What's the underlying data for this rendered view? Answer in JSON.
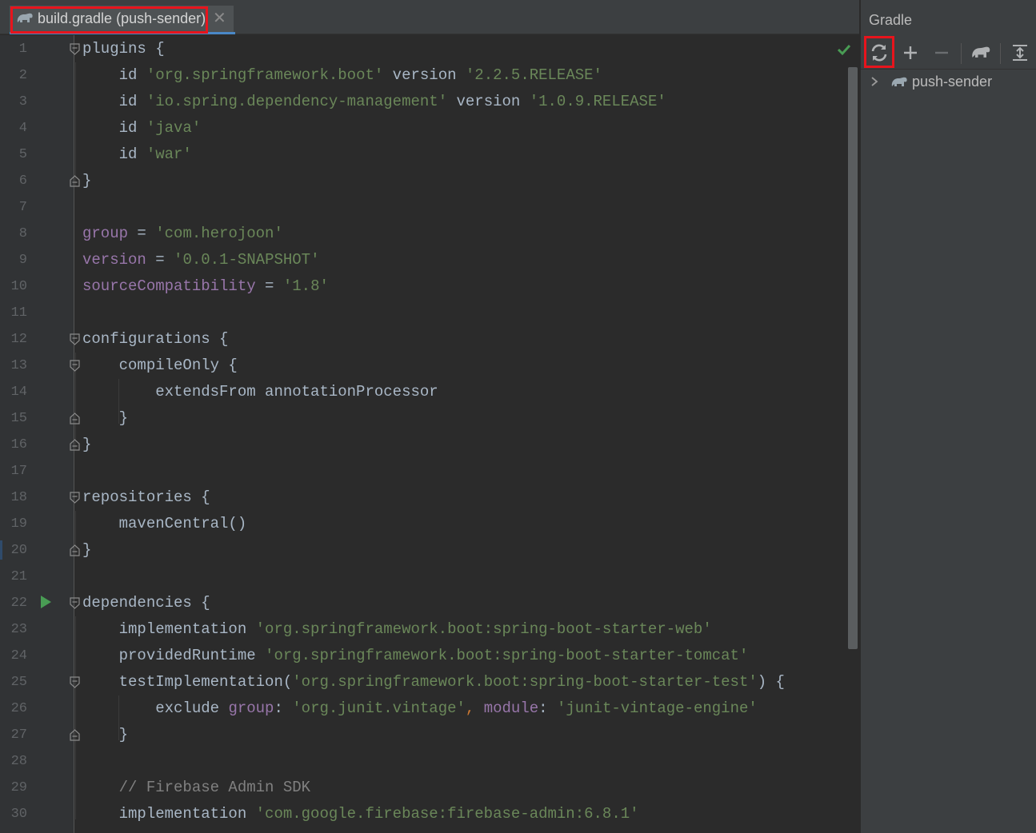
{
  "editor": {
    "tab": {
      "label": "build.gradle (push-sender)",
      "close_glyph": "✕",
      "icon": "gradle-elephant-icon"
    },
    "line_numbers": [
      "1",
      "2",
      "3",
      "4",
      "5",
      "6",
      "7",
      "8",
      "9",
      "10",
      "11",
      "12",
      "13",
      "14",
      "15",
      "16",
      "17",
      "18",
      "19",
      "20",
      "21",
      "22",
      "23",
      "24",
      "25",
      "26",
      "27",
      "28",
      "29",
      "30"
    ],
    "lines": [
      [
        {
          "t": "plugins {",
          "c": ""
        }
      ],
      [
        {
          "t": "    id ",
          "c": ""
        },
        {
          "t": "'org.springframework.boot'",
          "c": "str"
        },
        {
          "t": " version ",
          "c": ""
        },
        {
          "t": "'2.2.5.RELEASE'",
          "c": "str"
        }
      ],
      [
        {
          "t": "    id ",
          "c": ""
        },
        {
          "t": "'io.spring.dependency-management'",
          "c": "str"
        },
        {
          "t": " version ",
          "c": ""
        },
        {
          "t": "'1.0.9.RELEASE'",
          "c": "str"
        }
      ],
      [
        {
          "t": "    id ",
          "c": ""
        },
        {
          "t": "'java'",
          "c": "str"
        }
      ],
      [
        {
          "t": "    id ",
          "c": ""
        },
        {
          "t": "'war'",
          "c": "str"
        }
      ],
      [
        {
          "t": "}",
          "c": ""
        }
      ],
      [],
      [
        {
          "t": "group",
          "c": "prop"
        },
        {
          "t": " = ",
          "c": ""
        },
        {
          "t": "'com.herojoon'",
          "c": "str"
        }
      ],
      [
        {
          "t": "version",
          "c": "prop"
        },
        {
          "t": " = ",
          "c": ""
        },
        {
          "t": "'0.0.1-SNAPSHOT'",
          "c": "str"
        }
      ],
      [
        {
          "t": "sourceCompatibility",
          "c": "prop"
        },
        {
          "t": " = ",
          "c": ""
        },
        {
          "t": "'1.8'",
          "c": "str"
        }
      ],
      [],
      [
        {
          "t": "configurations {",
          "c": ""
        }
      ],
      [
        {
          "t": "    compileOnly {",
          "c": ""
        }
      ],
      [
        {
          "t": "        extendsFrom annotationProcessor",
          "c": ""
        }
      ],
      [
        {
          "t": "    }",
          "c": ""
        }
      ],
      [
        {
          "t": "}",
          "c": ""
        }
      ],
      [],
      [
        {
          "t": "repositories {",
          "c": ""
        }
      ],
      [
        {
          "t": "    mavenCentral()",
          "c": ""
        }
      ],
      [
        {
          "t": "}",
          "c": ""
        }
      ],
      [],
      [
        {
          "t": "dependencies {",
          "c": ""
        }
      ],
      [
        {
          "t": "    implementation ",
          "c": ""
        },
        {
          "t": "'org.springframework.boot:spring-boot-starter-web'",
          "c": "str"
        }
      ],
      [
        {
          "t": "    providedRuntime ",
          "c": ""
        },
        {
          "t": "'org.springframework.boot:spring-boot-starter-tomcat'",
          "c": "str"
        }
      ],
      [
        {
          "t": "    testImplementation(",
          "c": ""
        },
        {
          "t": "'org.springframework.boot:spring-boot-starter-test'",
          "c": "str"
        },
        {
          "t": ") {",
          "c": ""
        }
      ],
      [
        {
          "t": "        exclude ",
          "c": ""
        },
        {
          "t": "group",
          "c": "prop"
        },
        {
          "t": ": ",
          "c": ""
        },
        {
          "t": "'org.junit.vintage'",
          "c": "str"
        },
        {
          "t": ", ",
          "c": "kw"
        },
        {
          "t": "module",
          "c": "prop"
        },
        {
          "t": ": ",
          "c": ""
        },
        {
          "t": "'junit-vintage-engine'",
          "c": "str"
        }
      ],
      [
        {
          "t": "    }",
          "c": ""
        }
      ],
      [],
      [
        {
          "t": "    // Firebase Admin SDK",
          "c": "cm"
        }
      ],
      [
        {
          "t": "    implementation ",
          "c": ""
        },
        {
          "t": "'com.google.firebase:firebase-admin:6.8.1'",
          "c": "str"
        }
      ]
    ],
    "fold_markers": [
      {
        "line": 1,
        "kind": "open"
      },
      {
        "line": 6,
        "kind": "close"
      },
      {
        "line": 12,
        "kind": "open"
      },
      {
        "line": 13,
        "kind": "open"
      },
      {
        "line": 15,
        "kind": "close"
      },
      {
        "line": 16,
        "kind": "close"
      },
      {
        "line": 18,
        "kind": "open"
      },
      {
        "line": 20,
        "kind": "close"
      },
      {
        "line": 22,
        "kind": "open"
      },
      {
        "line": 25,
        "kind": "open"
      },
      {
        "line": 27,
        "kind": "close"
      }
    ],
    "run_marker_line": 22,
    "status_icon": "check-icon"
  },
  "gradle_panel": {
    "title": "Gradle",
    "toolbar": [
      {
        "name": "reload-gradle-button",
        "icon": "refresh-icon"
      },
      {
        "name": "add-gradle-project-button",
        "icon": "plus-icon"
      },
      {
        "name": "remove-gradle-project-button",
        "icon": "minus-icon"
      },
      {
        "name": "execute-gradle-task-button",
        "icon": "gradle-elephant-icon"
      },
      {
        "name": "expand-all-button",
        "icon": "expand-all-icon"
      }
    ],
    "tree": [
      {
        "label": "push-sender",
        "icon": "gradle-elephant-icon",
        "expanded": false
      }
    ]
  },
  "colors": {
    "background": "#2b2b2b",
    "keyword": "#cc7832",
    "string": "#6a8759",
    "property": "#9876aa",
    "comment": "#808080",
    "text": "#a9b7c6",
    "highlight": "#e8141c"
  }
}
